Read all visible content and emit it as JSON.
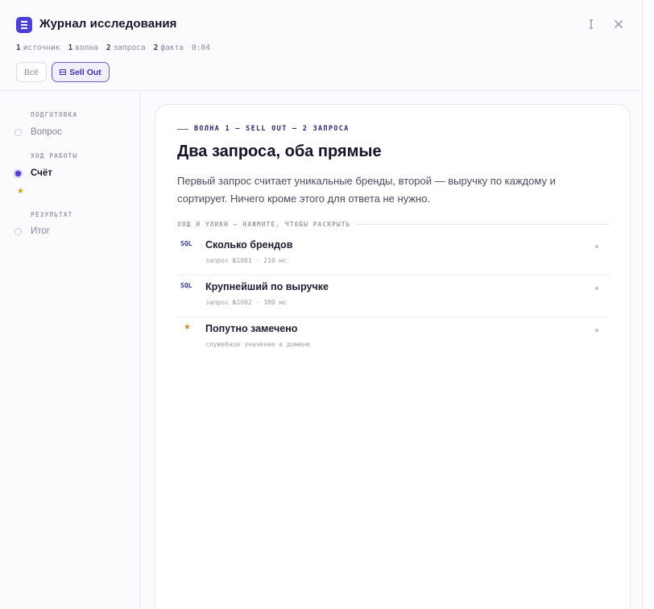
{
  "header": {
    "title": "Журнал исследования",
    "icons": {
      "app": "journal-icon",
      "cursor": "text-cursor-icon",
      "close": "close-icon"
    },
    "stats": [
      {
        "count": "1",
        "label": "источник"
      },
      {
        "count": "1",
        "label": "волна"
      },
      {
        "count": "2",
        "label": "запроса"
      },
      {
        "count": "2",
        "label": "факта"
      }
    ],
    "time": "0:04",
    "filters": {
      "all": "Всё",
      "sellout": "Sell Out"
    }
  },
  "sidebar": {
    "sections": [
      "ПОДГОТОВКА",
      "ХОД РАБОТЫ",
      "РЕЗУЛЬТАТ"
    ],
    "items": {
      "question": "Вопрос",
      "count": "Счёт",
      "result": "Итог"
    },
    "star": "★"
  },
  "card": {
    "wave": "ВОЛНА 1 — SELL OUT — 2 ЗАПРОСА",
    "title": "Два запроса, оба прямые",
    "description": "Первый запрос считает уникальные бренды, второй — выручку по каждому и сортирует. Ничего кроме этого для ответа не нужно.",
    "clues_label": "ХОД И УЛИКИ — НАЖМИТЕ, ЧТОБЫ РАСКРЫТЬ",
    "clues": [
      {
        "badge": "SQL",
        "title": "Сколько брендов",
        "meta": "запрос №1001 · 210 мс"
      },
      {
        "badge": "SQL",
        "title": "Крупнейший по выручке",
        "meta": "запрос №1002 · 380 мс"
      },
      {
        "badge": "★",
        "title": "Попутно замечено",
        "meta": "служебное значение в домене"
      }
    ]
  },
  "colors": {
    "accent": "#4b3fd4",
    "star": "#d4882a"
  }
}
